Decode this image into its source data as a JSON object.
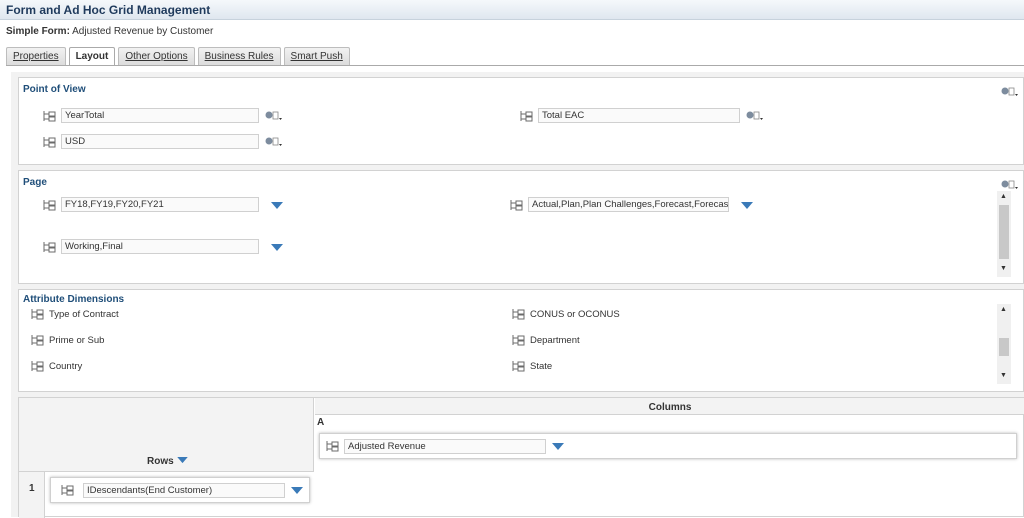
{
  "window": {
    "title": "Form and Ad Hoc Grid Management"
  },
  "form": {
    "type_label": "Simple Form:",
    "name": "Adjusted Revenue by Customer"
  },
  "tabs": [
    {
      "label": "Properties"
    },
    {
      "label": "Layout"
    },
    {
      "label": "Other Options"
    },
    {
      "label": "Business Rules"
    },
    {
      "label": "Smart Push"
    }
  ],
  "pov": {
    "title": "Point of View",
    "members": [
      "YearTotal",
      "Total EAC",
      "USD"
    ]
  },
  "page": {
    "title": "Page",
    "members": [
      "FY18,FY19,FY20,FY21",
      "Actual,Plan,Plan Challenges,Forecast,Forecast",
      "Working,Final"
    ]
  },
  "attributes": {
    "title": "Attribute Dimensions",
    "items": [
      "Type of Contract",
      "CONUS or OCONUS",
      "Prime or Sub",
      "Department",
      "Country",
      "State"
    ]
  },
  "grid": {
    "columns_label": "Columns",
    "rows_label": "Rows",
    "column_id": "A",
    "column_member": "Adjusted Revenue",
    "row_number": "1",
    "row_member": "IDescendants(End Customer)"
  },
  "colors": {
    "title_text": "#1f3a5c",
    "section_title": "#1f4e79",
    "dropdown_arrow": "#3a7ab8"
  }
}
